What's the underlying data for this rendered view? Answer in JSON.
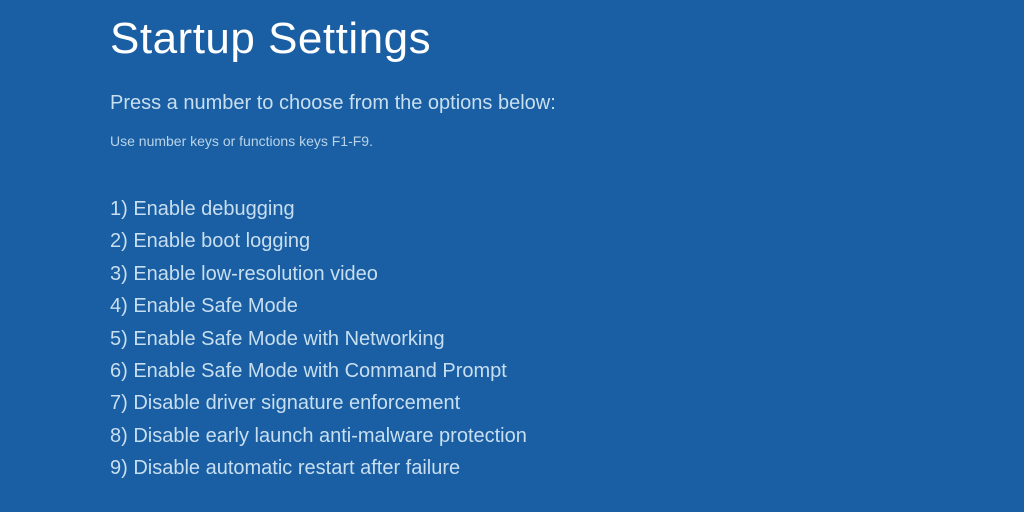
{
  "title": "Startup Settings",
  "subtitle": "Press a number to choose from the options below:",
  "hint": "Use number keys or functions keys F1-F9.",
  "options": [
    "1) Enable debugging",
    "2) Enable boot logging",
    "3) Enable low-resolution video",
    "4) Enable Safe Mode",
    "5) Enable Safe Mode with Networking",
    "6) Enable Safe Mode with Command Prompt",
    "7) Disable driver signature enforcement",
    "8) Disable early launch anti-malware protection",
    "9) Disable automatic restart after failure"
  ]
}
